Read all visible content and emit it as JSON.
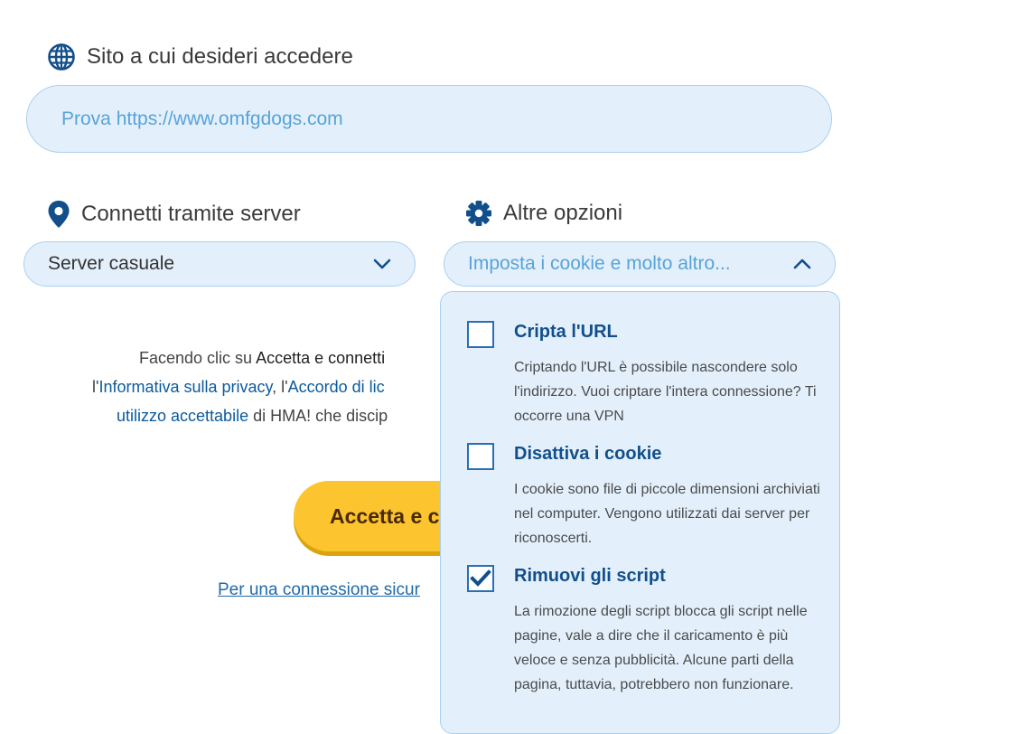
{
  "site": {
    "label": "Sito a cui desideri accedere",
    "placeholder": "Prova https://www.omfgdogs.com"
  },
  "server": {
    "label": "Connetti tramite server",
    "value": "Server casuale"
  },
  "options": {
    "label": "Altre opzioni",
    "value": "Imposta i cookie e molto altro...",
    "items": [
      {
        "title": "Cripta l'URL",
        "desc": "Criptando l'URL è possibile nascondere solo l'indirizzo. Vuoi criptare l'intera connessione? Ti occorre una VPN",
        "checked": false
      },
      {
        "title": "Disattiva i cookie",
        "desc": "I cookie sono file di piccole dimensioni archiviati nel computer. Vengono utilizzati dai server per riconoscerti.",
        "checked": false
      },
      {
        "title": "Rimuovi gli script",
        "desc": "La rimozione degli script blocca gli script nelle pagine, vale a dire che il caricamento è più veloce e senza pubblicità. Alcune parti della pagina, tuttavia, potrebbero non funzionare.",
        "checked": true
      }
    ]
  },
  "legal": {
    "l1_a": "Facendo clic su ",
    "l1_b": "Accetta e connetti",
    "l2_a": "l'",
    "l2_b": "Informativa sulla privacy",
    "l2_c": ", l'",
    "l2_d": "Accordo di lic",
    "l3_a": "utilizzo accettabile",
    "l3_b": " di HMA! che discip"
  },
  "button": {
    "label": "Accetta e c"
  },
  "secure_link": "Per una connessione sicur"
}
